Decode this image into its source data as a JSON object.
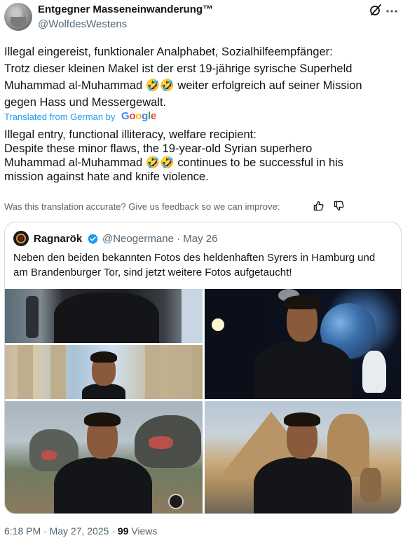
{
  "author": {
    "name": "Entgegner Masseneinwanderung™",
    "handle": "@WolfdesWestens"
  },
  "tweet": {
    "original_lines": [
      "Illegal eingereist, funktionaler Analphabet, Sozialhilfeempfänger:",
      "Trotz dieser kleinen Makel ist der erst 19-jährige syrische Superheld",
      "Muhammad al-Muhammad 🤣🤣 weiter erfolgreich auf seiner Mission",
      "gegen Hass und Messergewalt."
    ],
    "translated_label": "Translated from German by",
    "translated_by": "Google",
    "translation_lines": [
      "Illegal entry, functional illiteracy, welfare recipient:",
      "Despite these minor flaws, the 19-year-old Syrian superhero",
      "Muhammad al-Muhammad 🤣🤣 continues to be successful in his",
      "mission against hate and knife violence."
    ],
    "feedback_prompt": "Was this translation accurate? Give us feedback so we can improve:"
  },
  "quote": {
    "name": "Ragnarök",
    "handle_date": "@Neogermane · May 26",
    "text_lines": [
      "Neben den beiden bekannten Fotos des heldenhaften Syrers in Hamburg und",
      "am Brandenburger Tor, sind jetzt weitere Fotos aufgetaucht!"
    ]
  },
  "footer": {
    "timestamp": "6:18 PM · May 27, 2025 · ",
    "views_count": "99",
    "views_label": " Views"
  },
  "icons": {
    "grok": "grok-icon",
    "more": "more-icon",
    "verified": "verified-icon",
    "thumb_up": "thumb-up-icon",
    "thumb_down": "thumb-down-icon"
  },
  "colors": {
    "link_blue": "#1d9bf0",
    "secondary_text": "#536471",
    "border": "#cfd9de"
  }
}
